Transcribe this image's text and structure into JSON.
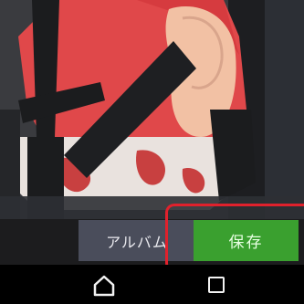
{
  "actions": {
    "album_label": "アルバム",
    "save_label": "保存"
  },
  "nav": {
    "home_icon": "home-icon",
    "recents_icon": "recents-icon"
  },
  "colors": {
    "save_button": "#3aa02f",
    "album_button": "#4a4d5b",
    "highlight": "#e0212c"
  }
}
